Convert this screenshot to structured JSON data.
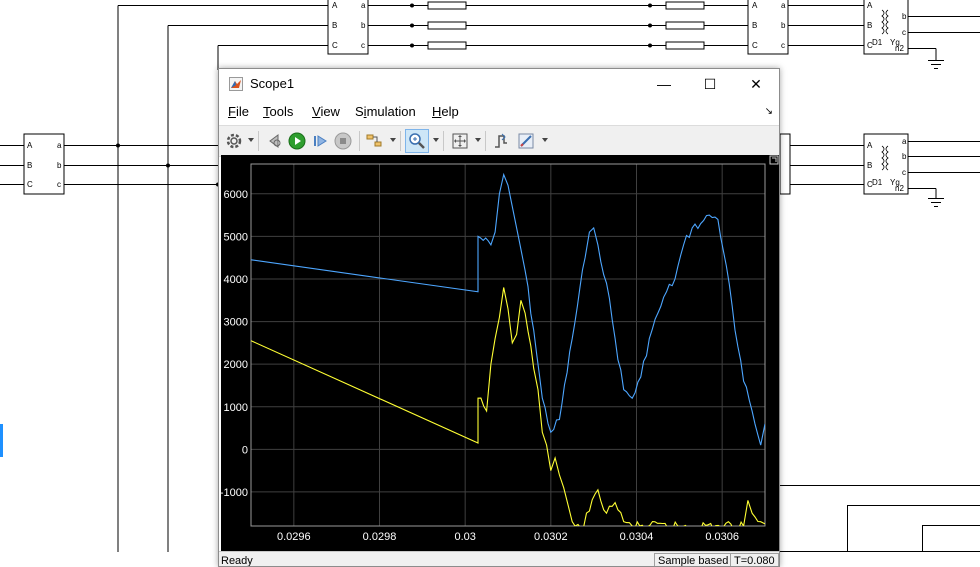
{
  "window": {
    "title": "Scope1",
    "controls": {
      "minimize": "—",
      "maximize": "☐",
      "close": "✕"
    }
  },
  "menu": {
    "items": [
      {
        "label": "File",
        "accel": "F",
        "rest": "ile"
      },
      {
        "label": "Tools",
        "accel": "T",
        "rest": "ools"
      },
      {
        "label": "View",
        "accel": "V",
        "rest": "iew"
      },
      {
        "label": "Simulation",
        "pre": "S",
        "accel": "i",
        "rest": "mulation"
      },
      {
        "label": "Help",
        "accel": "H",
        "rest": "elp"
      }
    ],
    "collapse_glyph": "↘"
  },
  "toolbar": {
    "icons": [
      "gear-icon",
      "step-back-icon",
      "run-icon",
      "step-forward-icon",
      "stop-icon",
      "highlight-icon",
      "zoom-in-icon",
      "fit-to-view-icon",
      "triggers-icon",
      "style-icon"
    ]
  },
  "diagram": {
    "ports_in": [
      "A",
      "B",
      "C"
    ],
    "ports_out": [
      "a",
      "b",
      "c"
    ],
    "transformer_labels": [
      "D1",
      "Yg",
      "n2"
    ]
  },
  "status": {
    "ready": "Ready",
    "sample": "Sample based",
    "time": "T=0.080"
  },
  "chart_data": {
    "type": "line",
    "title": "",
    "xlabel": "",
    "ylabel": "",
    "xlim": [
      0.0295,
      0.0307
    ],
    "ylim": [
      -1800,
      6700
    ],
    "xticks": [
      0.0296,
      0.0298,
      0.03,
      0.0302,
      0.0304,
      0.0306
    ],
    "xtick_labels": [
      "0.0296",
      "0.0298",
      "0.03",
      "0.0302",
      "0.0304",
      "0.0306"
    ],
    "yticks": [
      -1000,
      0,
      1000,
      2000,
      3000,
      4000,
      5000,
      6000
    ],
    "ytick_labels": [
      "-1000",
      "0",
      "1000",
      "2000",
      "3000",
      "4000",
      "5000",
      "6000"
    ],
    "grid": true,
    "colors": {
      "background": "#000000",
      "grid": "#404040",
      "axis_text": "#ffffff"
    },
    "series": [
      {
        "color": "#4da6ff",
        "x": [
          0.0295,
          0.03003,
          0.03003,
          0.03006,
          0.03007,
          0.03008,
          0.03009,
          0.0301,
          0.03011,
          0.03012,
          0.03014,
          0.03016,
          0.03018,
          0.0302,
          0.03022,
          0.03025,
          0.03028,
          0.03029,
          0.0303,
          0.03031,
          0.03033,
          0.03035,
          0.03037,
          0.03039,
          0.03041,
          0.03043,
          0.03045,
          0.03047,
          0.03049,
          0.03051,
          0.03053,
          0.03055,
          0.03057,
          0.03059,
          0.03061,
          0.03063,
          0.03065,
          0.03067,
          0.03069,
          0.0307
        ],
        "y": [
          4450,
          3700,
          5000,
          4800,
          5100,
          6000,
          6450,
          6200,
          5700,
          5200,
          4200,
          2800,
          1200,
          400,
          700,
          2600,
          4500,
          5100,
          5200,
          4800,
          3900,
          2600,
          1400,
          1200,
          1700,
          2600,
          3200,
          3700,
          4000,
          4800,
          5200,
          5300,
          5500,
          5400,
          4300,
          2800,
          1600,
          900,
          100,
          600
        ]
      },
      {
        "color": "#ffff33",
        "x": [
          0.0295,
          0.03003,
          0.03003,
          0.03005,
          0.03006,
          0.03007,
          0.03008,
          0.03009,
          0.0301,
          0.03011,
          0.03012,
          0.03013,
          0.03014,
          0.03016,
          0.03017,
          0.03018,
          0.03019,
          0.0302,
          0.03021,
          0.03022,
          0.03023,
          0.03024,
          0.03025,
          0.03027,
          0.03029,
          0.03031,
          0.03033,
          0.03035,
          0.03037,
          0.03039,
          0.03065,
          0.03066,
          0.03067,
          0.03069,
          0.0307
        ],
        "y": [
          2550,
          150,
          1200,
          900,
          2000,
          2600,
          3100,
          3800,
          3300,
          2500,
          2700,
          3500,
          3200,
          1900,
          1400,
          400,
          100,
          -500,
          -200,
          -600,
          -900,
          -1300,
          -1700,
          -1850,
          -1450,
          -950,
          -1500,
          -1250,
          -1700,
          -1800,
          -1800,
          -1200,
          -1500,
          -1700,
          -1750
        ]
      }
    ]
  }
}
